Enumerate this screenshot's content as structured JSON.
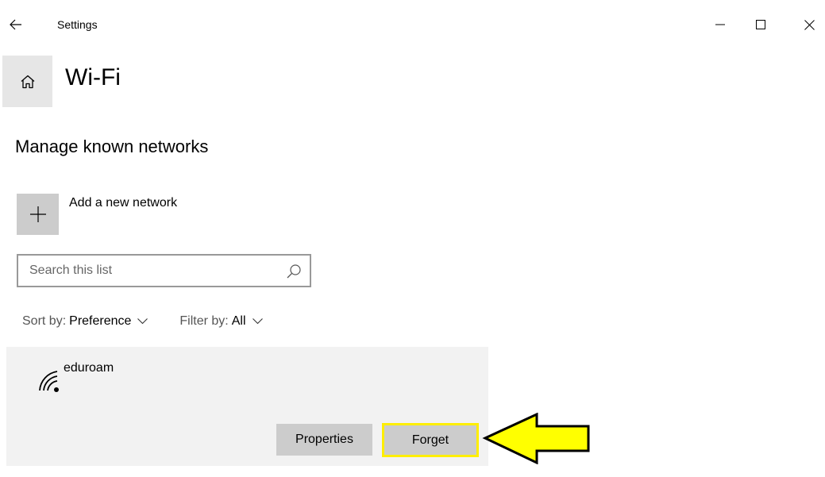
{
  "window": {
    "title": "Settings"
  },
  "header": {
    "page_title": "Wi-Fi"
  },
  "section": {
    "title": "Manage known networks"
  },
  "add_network": {
    "label": "Add a new network"
  },
  "search": {
    "placeholder": "Search this list",
    "value": ""
  },
  "sort": {
    "label": "Sort by:",
    "value": "Preference"
  },
  "filter": {
    "label": "Filter by:",
    "value": "All"
  },
  "networks": [
    {
      "name": "eduroam",
      "properties_label": "Properties",
      "forget_label": "Forget"
    }
  ],
  "colors": {
    "home_tile": "#e6e6e6",
    "add_tile": "#cccccc",
    "card_bg": "#f2f2f2",
    "button_bg": "#cccccc",
    "highlight": "#ffee00",
    "arrow_fill": "#ffff00"
  },
  "icons": {
    "back": "arrow-left-icon",
    "home": "home-icon",
    "add": "plus-icon",
    "search": "search-icon",
    "wifi": "wifi-icon",
    "minimize": "minimize-icon",
    "maximize": "maximize-icon",
    "close": "close-icon",
    "annotation": "arrow-annotation-icon"
  }
}
